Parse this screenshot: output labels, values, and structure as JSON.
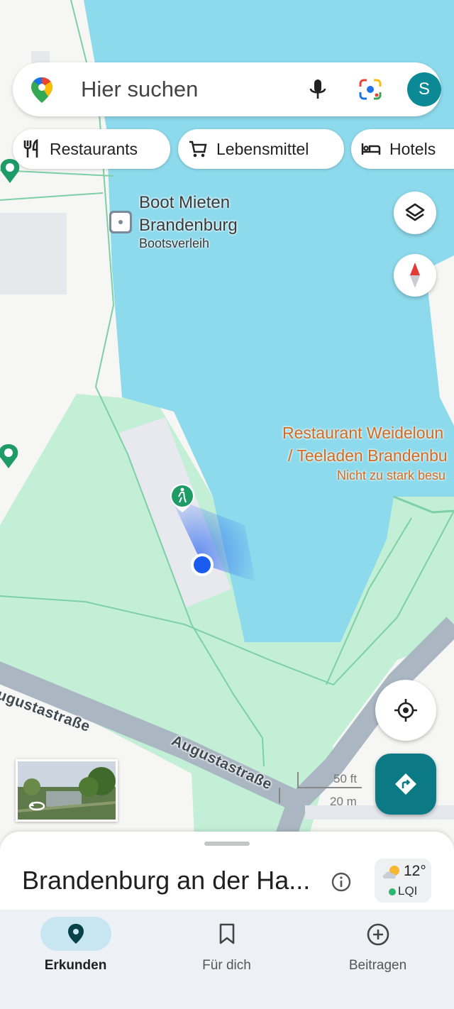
{
  "search": {
    "placeholder": "Hier suchen",
    "avatar_initial": "S"
  },
  "chips": [
    {
      "label": "Restaurants",
      "icon": "cutlery-icon"
    },
    {
      "label": "Lebensmittel",
      "icon": "shopping-cart-icon"
    },
    {
      "label": "Hotels",
      "icon": "bed-icon"
    }
  ],
  "map": {
    "poi_boat": {
      "name_line1": "Boot Mieten",
      "name_line2": "Brandenburg",
      "category": "Bootsverleih"
    },
    "poi_restaurant": {
      "name_line1": "Restaurant Weideloun",
      "name_line2": "/ Teeladen Brandenbu",
      "status": "Nicht zu stark besu"
    },
    "streets": [
      "Augustastraße",
      "Augustastraße"
    ],
    "scale": {
      "feet": "50 ft",
      "meters": "20 m"
    },
    "colors": {
      "water": "#8ddaec",
      "park": "#c2efd6",
      "land": "#f6f6f4",
      "road": "#aab7c3",
      "user_location": "#1a5cf0",
      "accent": "#0b7a85"
    }
  },
  "bottom_sheet": {
    "title": "Brandenburg an der Ha...",
    "weather": {
      "temp": "12°",
      "aqi": "LQI"
    }
  },
  "nav": [
    {
      "label": "Erkunden",
      "icon": "location-pin-icon",
      "active": true
    },
    {
      "label": "Für dich",
      "icon": "bookmark-icon",
      "active": false
    },
    {
      "label": "Beitragen",
      "icon": "plus-circle-icon",
      "active": false
    }
  ]
}
